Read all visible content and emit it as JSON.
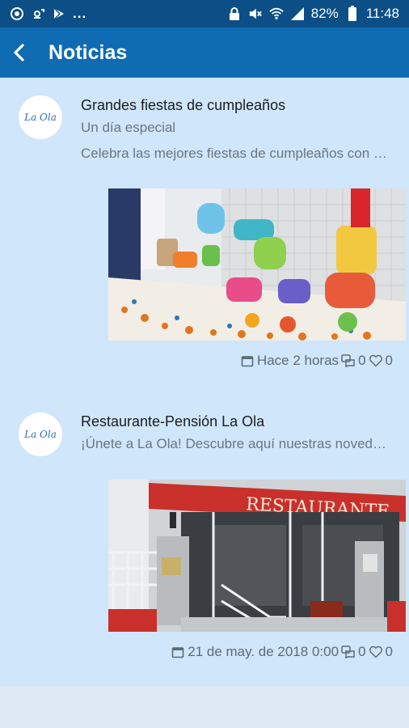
{
  "status_bar": {
    "battery_percent": "82%",
    "time": "11:48",
    "overflow": "..."
  },
  "app_bar": {
    "title": "Noticias"
  },
  "avatar_logo_text": "La Ola",
  "news": [
    {
      "title": "Grandes fiestas de cumpleaños",
      "subtitle": "Un día especial",
      "summary": "Celebra las mejores fiestas de cumpleaños con nosotros",
      "date": "Hace 2 horas",
      "comments": "0",
      "likes": "0",
      "image_alt": "Candy bar party table"
    },
    {
      "title": "Restaurante-Pensión La Ola",
      "subtitle": "¡Únete a La Ola! Descubre aquí nuestras novedades",
      "date": "21 de may. de 2018 0:00",
      "comments": "0",
      "likes": "0",
      "image_sign": "RESTAURANTE",
      "image_alt": "Restaurant entrance"
    }
  ],
  "colors": {
    "status_bar": "#0b4f86",
    "app_bar": "#0f6bb2",
    "feed_bg": "#cfe6fb",
    "awning": "#c9302c"
  }
}
